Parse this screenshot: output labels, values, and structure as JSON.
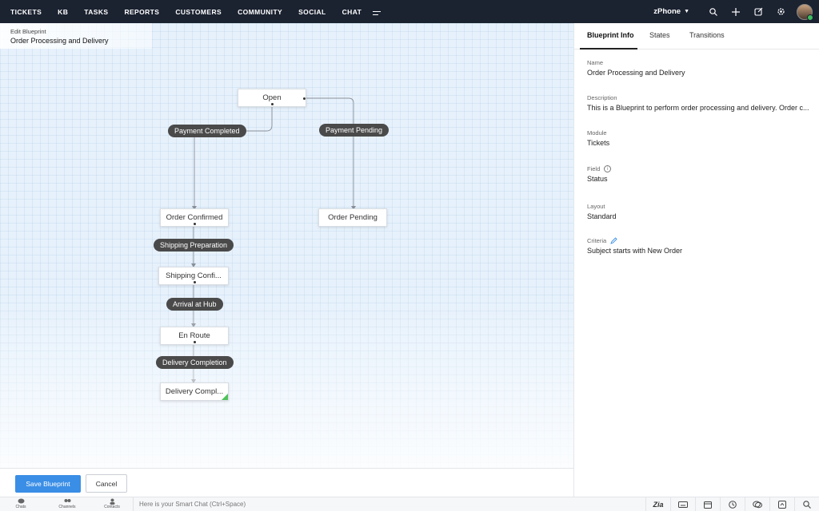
{
  "nav": {
    "items": [
      "TICKETS",
      "KB",
      "TASKS",
      "REPORTS",
      "CUSTOMERS",
      "COMMUNITY",
      "SOCIAL",
      "CHAT"
    ],
    "brand": "zPhone",
    "right_icons": [
      "search-icon",
      "plus-icon",
      "compose-icon",
      "gear-icon"
    ]
  },
  "breadcrumb": {
    "label": "Edit Blueprint",
    "title": "Order Processing and Delivery"
  },
  "blueprint": {
    "states": [
      {
        "id": "open",
        "label": "Open"
      },
      {
        "id": "order-confirmed",
        "label": "Order Confirmed"
      },
      {
        "id": "order-pending",
        "label": "Order Pending"
      },
      {
        "id": "shipping-confirmed",
        "label": "Shipping Confi..."
      },
      {
        "id": "en-route",
        "label": "En Route"
      },
      {
        "id": "delivery-completed",
        "label": "Delivery Compl..."
      }
    ],
    "transitions": [
      {
        "id": "payment-completed",
        "label": "Payment Completed"
      },
      {
        "id": "payment-pending",
        "label": "Payment Pending"
      },
      {
        "id": "shipping-preparation",
        "label": "Shipping Preparation"
      },
      {
        "id": "arrival-at-hub",
        "label": "Arrival at Hub"
      },
      {
        "id": "delivery-completion",
        "label": "Delivery Completion"
      }
    ]
  },
  "actions": {
    "save": "Save Blueprint",
    "cancel": "Cancel"
  },
  "panel": {
    "tabs": [
      "Blueprint Info",
      "States",
      "Transitions"
    ],
    "active_tab": "Blueprint Info",
    "fields": {
      "name": {
        "label": "Name",
        "value": "Order Processing and Delivery"
      },
      "description": {
        "label": "Description",
        "value": "This is a Blueprint to perform order processing and delivery. Order c..."
      },
      "module": {
        "label": "Module",
        "value": "Tickets"
      },
      "field": {
        "label": "Field",
        "value": "Status"
      },
      "layout": {
        "label": "Layout",
        "value": "Standard"
      },
      "criteria": {
        "label": "Criteria",
        "value": "Subject starts with  New Order"
      }
    }
  },
  "statusbar": {
    "left": [
      "Chats",
      "Channels",
      "Contacts"
    ],
    "smart_chat_placeholder": "Here is your Smart Chat (Ctrl+Space)",
    "zia_label": "Zia"
  },
  "colors": {
    "nav_bg": "#1b2230",
    "primary": "#3a8ee6",
    "transition_pill": "#4a4a4a",
    "canvas_bg": "#e6f1fc",
    "complete_corner": "#4fc25a"
  }
}
